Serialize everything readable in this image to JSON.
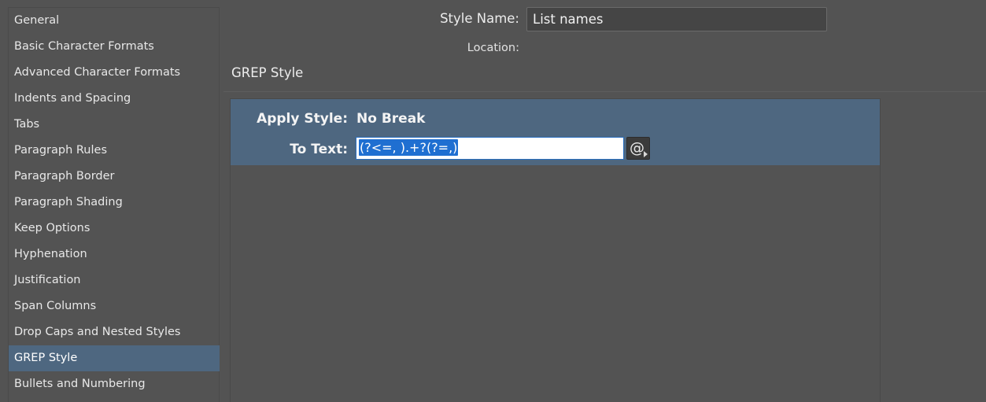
{
  "sidebar": {
    "items": [
      {
        "label": "General"
      },
      {
        "label": "Basic Character Formats"
      },
      {
        "label": "Advanced Character Formats"
      },
      {
        "label": "Indents and Spacing"
      },
      {
        "label": "Tabs"
      },
      {
        "label": "Paragraph Rules"
      },
      {
        "label": "Paragraph Border"
      },
      {
        "label": "Paragraph Shading"
      },
      {
        "label": "Keep Options"
      },
      {
        "label": "Hyphenation"
      },
      {
        "label": "Justification"
      },
      {
        "label": "Span Columns"
      },
      {
        "label": "Drop Caps and Nested Styles"
      },
      {
        "label": "GREP Style"
      },
      {
        "label": "Bullets and Numbering"
      }
    ],
    "selected": "GREP Style"
  },
  "header": {
    "style_name_label": "Style Name:",
    "style_name_value": "List names",
    "location_label": "Location:"
  },
  "section": {
    "title": "GREP Style"
  },
  "grep_style": {
    "apply_style_label": "Apply Style:",
    "apply_style_value": "No Break",
    "to_text_label": "To Text:",
    "to_text_value": "(?<=, ).+?(?=,)",
    "special_characters_icon": "at-sign-icon"
  },
  "colors": {
    "background": "#535353",
    "selection": "#4e6780",
    "text_highlight": "#1f6fd1"
  }
}
